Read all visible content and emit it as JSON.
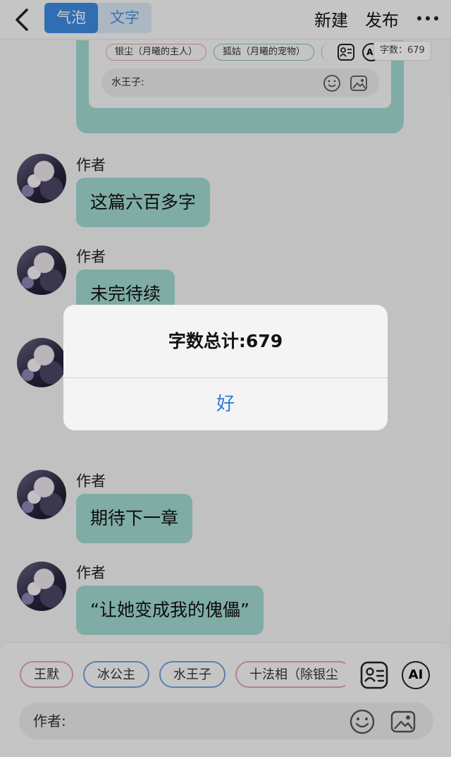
{
  "header": {
    "tabs": [
      {
        "label": "气泡",
        "active": true
      },
      {
        "label": "文字",
        "active": false
      }
    ],
    "actions": {
      "new": "新建",
      "publish": "发布"
    }
  },
  "preview_card": {
    "chips": [
      {
        "label": "银尘（月曦的主人）",
        "color": "red"
      },
      {
        "label": "狐姑（月曦的宠物）",
        "color": "teal"
      }
    ],
    "word_count_tag": "字数：679",
    "ai_label": "AI",
    "input_label": "水王子:"
  },
  "messages": [
    {
      "author": "作者",
      "text": "这篇六百多字"
    },
    {
      "author": "作者",
      "text": "未完待续"
    },
    {
      "author": "作者",
      "text": ""
    },
    {
      "author": "作者",
      "text": "期待下一章"
    },
    {
      "author": "作者",
      "text": "“让她变成我的傀儡”"
    }
  ],
  "composer": {
    "chips": [
      {
        "label": "王默",
        "color": "red"
      },
      {
        "label": "冰公主",
        "color": "blue"
      },
      {
        "label": "水王子",
        "color": "blue"
      },
      {
        "label": "十法相（除银尘",
        "color": "red"
      }
    ],
    "ai_label": "AI",
    "input_label": "作者:"
  },
  "alert": {
    "title": "字数总计:679",
    "ok_label": "好"
  },
  "colors": {
    "bubble": "#9fd8cf",
    "accent_blue": "#3b8ae0",
    "alert_button": "#3478d6"
  },
  "icons": [
    "back-chevron-icon",
    "more-dots-icon",
    "roster-icon",
    "ai-icon",
    "emoji-icon",
    "image-icon"
  ]
}
